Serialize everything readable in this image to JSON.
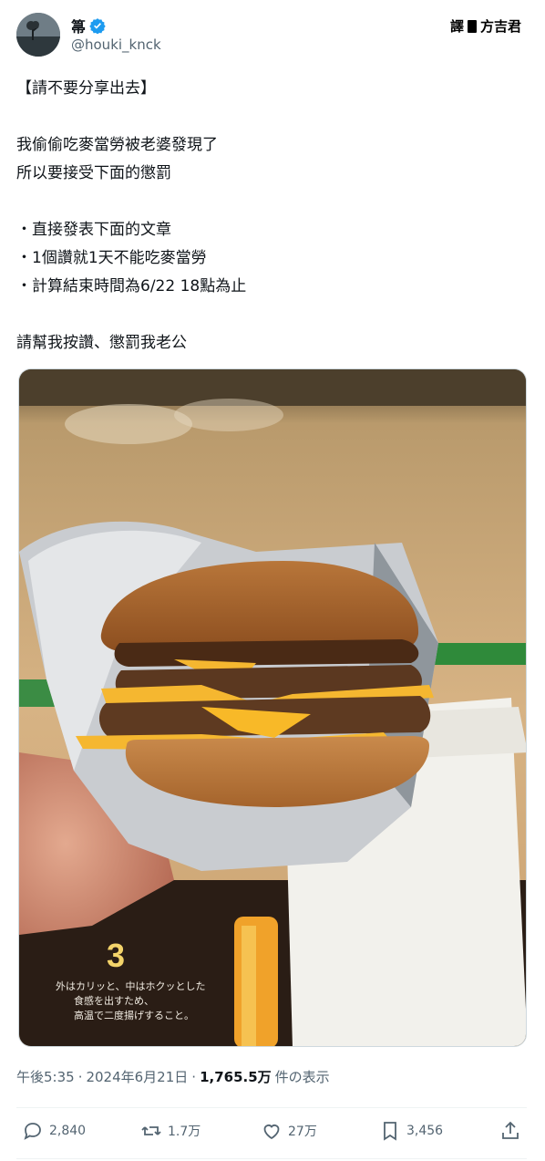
{
  "author": {
    "name": "箒",
    "handle": "@houki_knck"
  },
  "watermark": {
    "left": "譯",
    "right": "方吉君"
  },
  "tweet": {
    "text": "【請不要分享出去】\n\n我偷偷吃麥當勞被老婆發現了\n所以要接受下面的懲罰\n\n・直接發表下面的文章\n・1個讚就1天不能吃麥當勞\n・計算結束時間為6/22 18點為止\n\n請幫我按讚、懲罰我老公"
  },
  "photo": {
    "wrapper_print_1": "外はカリッと、中はホクッとした",
    "wrapper_print_2": "食感を出すため、",
    "wrapper_print_3": "高温で二度揚げすること。",
    "badge_number": "3"
  },
  "meta": {
    "time": "午後5:35",
    "sep1": "·",
    "date": "2024年6月21日",
    "sep2": "·",
    "views": "1,765.5万",
    "views_suffix": "件の表示"
  },
  "actions": {
    "replies": "2,840",
    "reposts": "1.7万",
    "likes": "27万",
    "bookmarks": "3,456"
  },
  "colors": {
    "verified": "#1d9bf0",
    "text": "#0f1419",
    "muted": "#536471"
  }
}
